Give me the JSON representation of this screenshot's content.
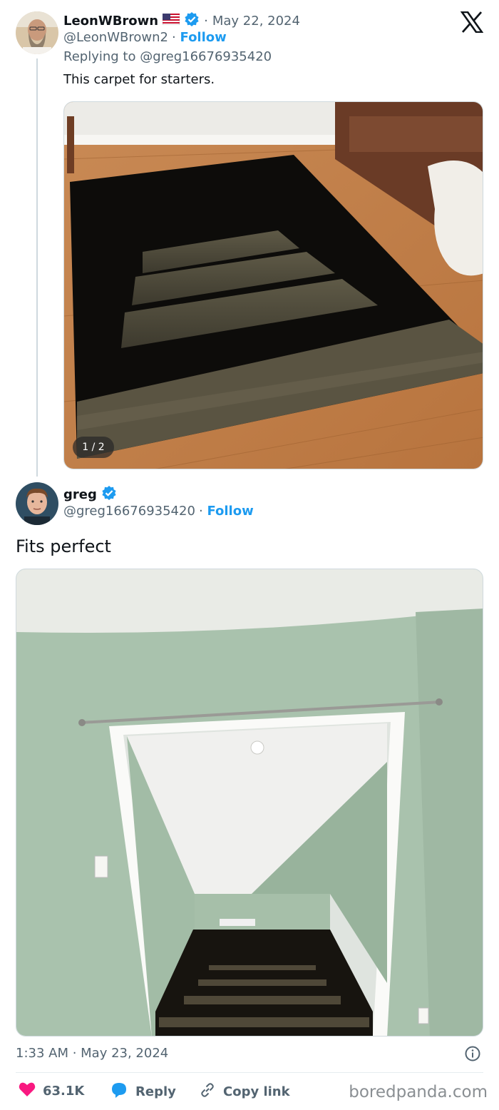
{
  "platform_logo": "X",
  "reply_tweet": {
    "display_name": "LeonWBrown",
    "flag": "us-flag-icon",
    "date": "May 22, 2024",
    "handle": "@LeonWBrown2",
    "follow_label": "Follow",
    "replying_to": "Replying to @greg16676935420",
    "text": "This carpet for starters.",
    "media_counter": "1 / 2"
  },
  "main_tweet": {
    "display_name": "greg",
    "handle": "@greg16676935420",
    "follow_label": "Follow",
    "text": "Fits perfect",
    "timestamp": "1:33 AM · May 23, 2024"
  },
  "actions": {
    "likes": "63.1K",
    "reply_label": "Reply",
    "copy_link_label": "Copy link"
  },
  "watermark": "boredpanda.com",
  "colors": {
    "accent": "#1d9bf0",
    "like": "#f91880",
    "muted": "#536471"
  }
}
